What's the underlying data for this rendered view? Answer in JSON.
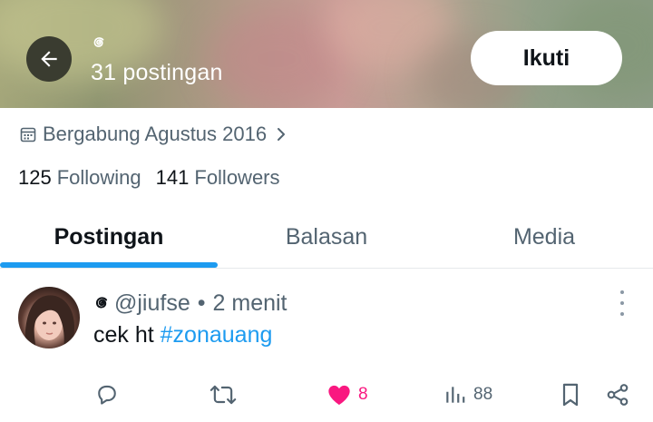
{
  "header": {
    "post_count": "31 postingan",
    "follow_label": "Ikuti",
    "icons": {
      "back": "back-arrow-icon",
      "spiral": "spiral-emoji-icon"
    }
  },
  "profile": {
    "joined": "Bergabung Agustus 2016",
    "following_count": "125",
    "following_label": "Following",
    "followers_count": "141",
    "followers_label": "Followers"
  },
  "tabs": [
    {
      "label": "Postingan",
      "active": true
    },
    {
      "label": "Balasan",
      "active": false
    },
    {
      "label": "Media",
      "active": false
    }
  ],
  "post": {
    "handle": "@jiufse",
    "separator": "•",
    "time": "2 menit",
    "text_plain": "cek ht ",
    "hashtag": "#zonauang",
    "actions": {
      "like_count": "8",
      "view_count": "88"
    }
  },
  "colors": {
    "accent": "#1d9bf0",
    "like": "#f91880",
    "secondary_text": "#536471",
    "primary_text": "#0f1419"
  }
}
